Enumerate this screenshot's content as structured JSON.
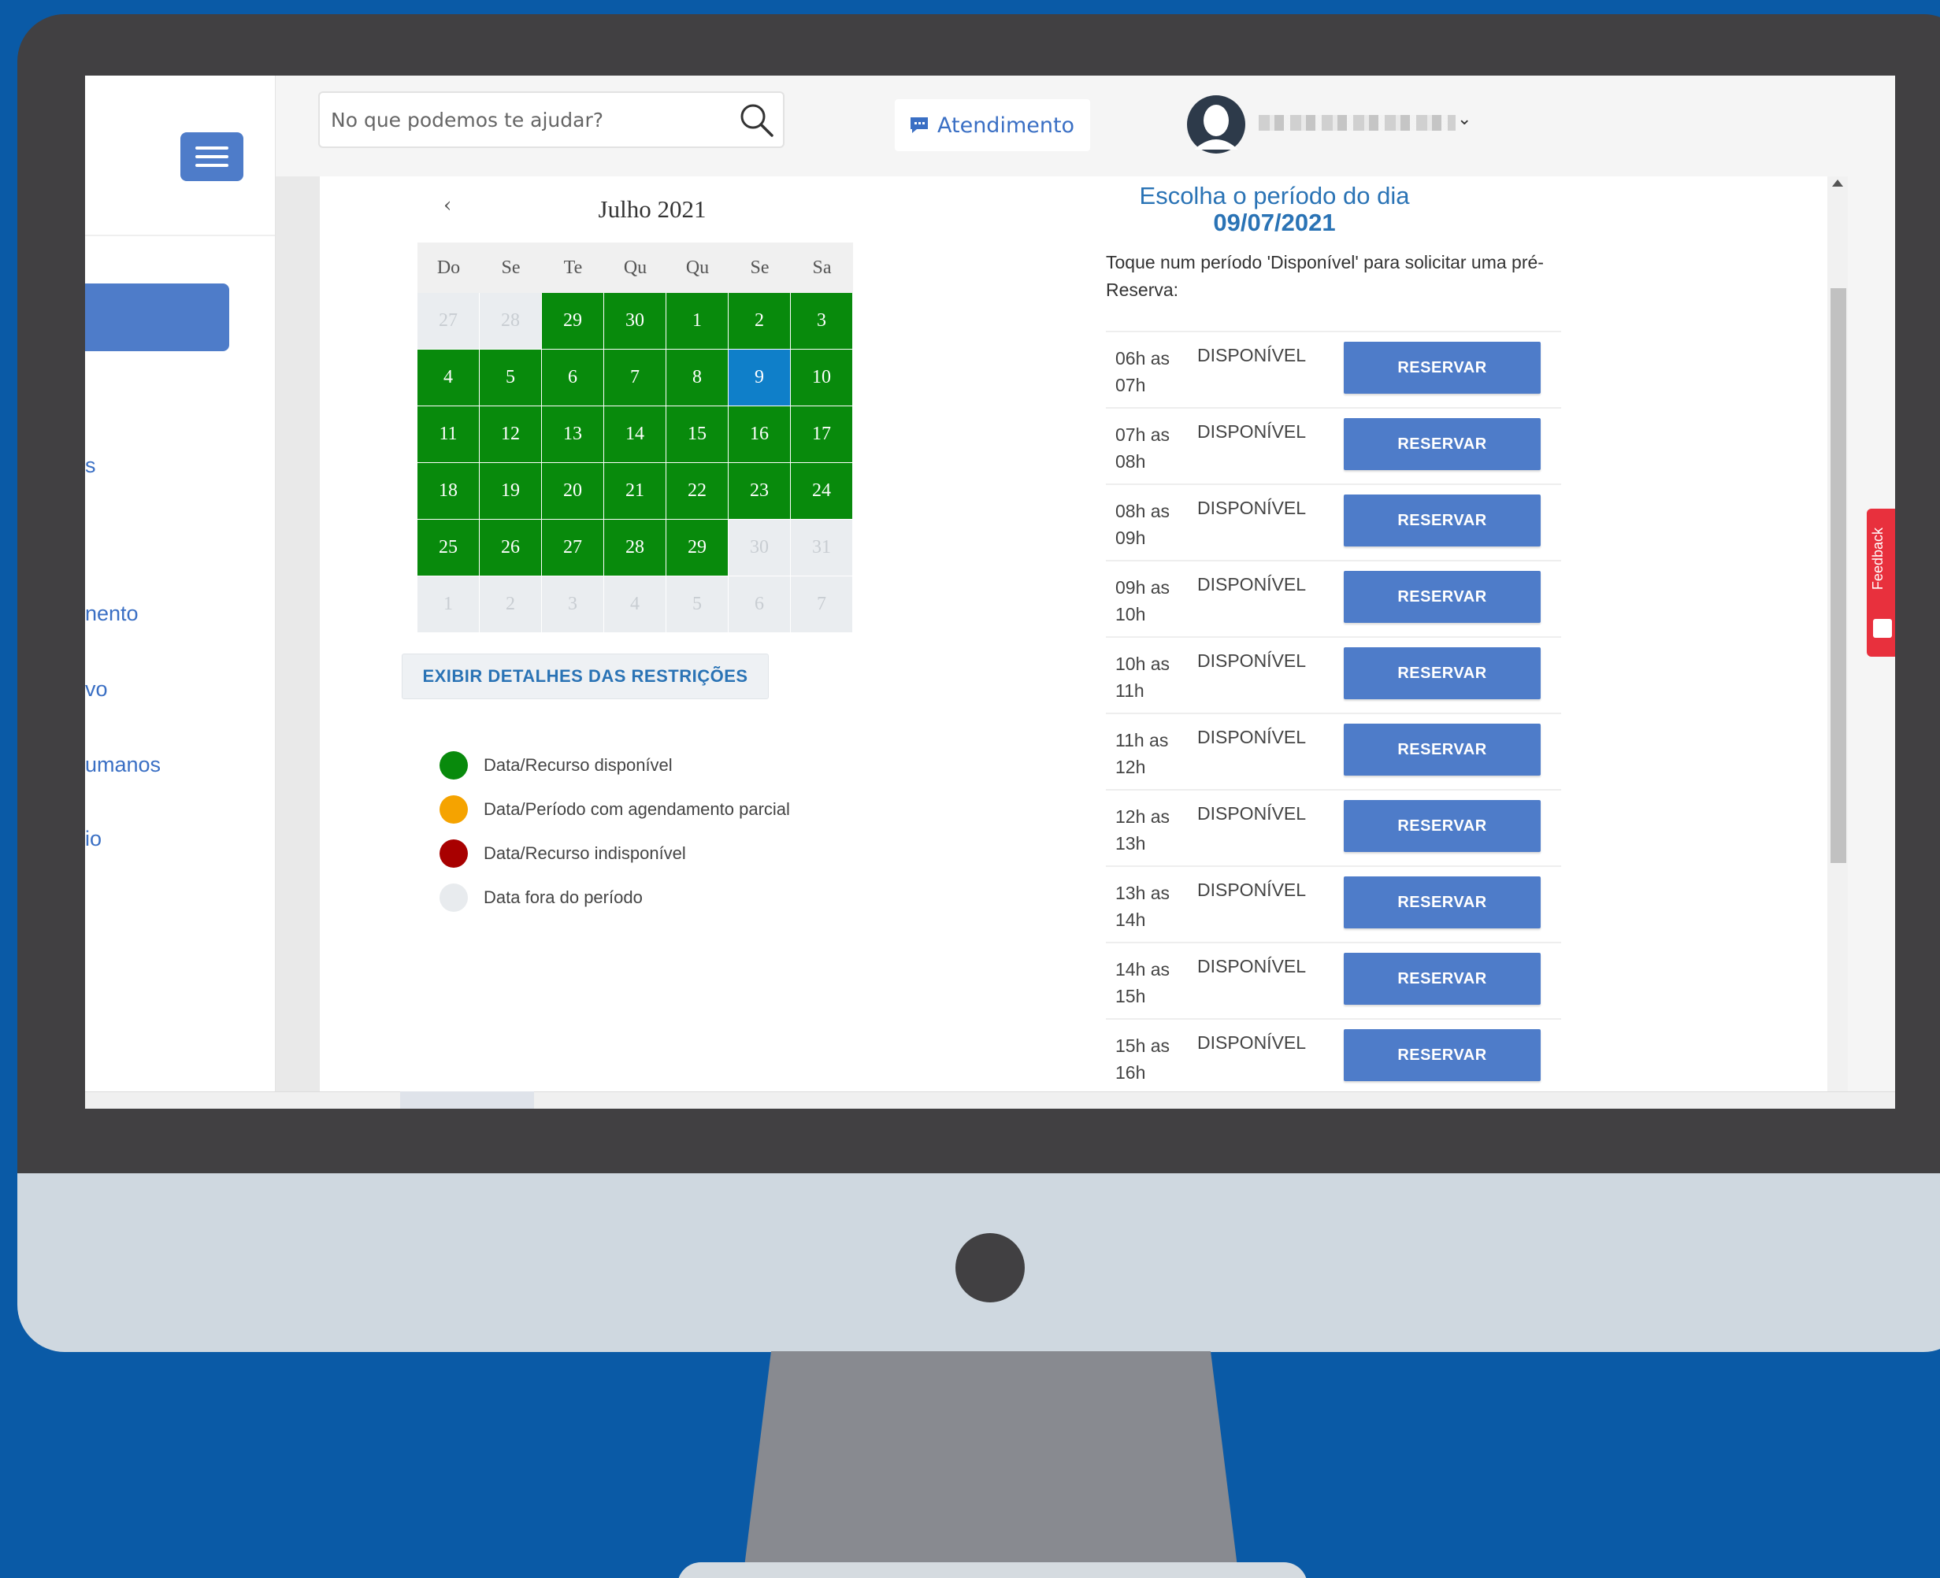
{
  "search": {
    "placeholder": "No que podemos te ajudar?"
  },
  "header": {
    "attend_label": "Atendimento",
    "user_name": ""
  },
  "sidebar": {
    "items": [
      "s",
      "nento",
      "vo",
      "umanos",
      "io"
    ]
  },
  "calendar": {
    "prev_label": "‹",
    "title": "Julho 2021",
    "weekdays": [
      "Do",
      "Se",
      "Te",
      "Qu",
      "Qu",
      "Se",
      "Sa"
    ],
    "days": [
      {
        "label": "27",
        "state": "out"
      },
      {
        "label": "28",
        "state": "out"
      },
      {
        "label": "29",
        "state": "available"
      },
      {
        "label": "30",
        "state": "available"
      },
      {
        "label": "1",
        "state": "available"
      },
      {
        "label": "2",
        "state": "available"
      },
      {
        "label": "3",
        "state": "available"
      },
      {
        "label": "4",
        "state": "available"
      },
      {
        "label": "5",
        "state": "available"
      },
      {
        "label": "6",
        "state": "available"
      },
      {
        "label": "7",
        "state": "available"
      },
      {
        "label": "8",
        "state": "available"
      },
      {
        "label": "9",
        "state": "selected"
      },
      {
        "label": "10",
        "state": "available"
      },
      {
        "label": "11",
        "state": "available"
      },
      {
        "label": "12",
        "state": "available"
      },
      {
        "label": "13",
        "state": "available"
      },
      {
        "label": "14",
        "state": "available"
      },
      {
        "label": "15",
        "state": "available"
      },
      {
        "label": "16",
        "state": "available"
      },
      {
        "label": "17",
        "state": "available"
      },
      {
        "label": "18",
        "state": "available"
      },
      {
        "label": "19",
        "state": "available"
      },
      {
        "label": "20",
        "state": "available"
      },
      {
        "label": "21",
        "state": "available"
      },
      {
        "label": "22",
        "state": "available"
      },
      {
        "label": "23",
        "state": "available"
      },
      {
        "label": "24",
        "state": "available"
      },
      {
        "label": "25",
        "state": "available"
      },
      {
        "label": "26",
        "state": "available"
      },
      {
        "label": "27",
        "state": "available"
      },
      {
        "label": "28",
        "state": "available"
      },
      {
        "label": "29",
        "state": "available"
      },
      {
        "label": "30",
        "state": "out"
      },
      {
        "label": "31",
        "state": "out"
      },
      {
        "label": "1",
        "state": "out"
      },
      {
        "label": "2",
        "state": "out"
      },
      {
        "label": "3",
        "state": "out"
      },
      {
        "label": "4",
        "state": "out"
      },
      {
        "label": "5",
        "state": "out"
      },
      {
        "label": "6",
        "state": "out"
      },
      {
        "label": "7",
        "state": "out"
      }
    ]
  },
  "restrictions_button_label": "EXIBIR DETALHES DAS RESTRIÇÕES",
  "legend": [
    {
      "label": "Data/Recurso disponível",
      "color": "#088a0c"
    },
    {
      "label": "Data/Período com agendamento parcial",
      "color": "#f5a300"
    },
    {
      "label": "Data/Recurso indisponível",
      "color": "#a80000"
    },
    {
      "label": "Data fora do período",
      "color": "#e8ebee"
    }
  ],
  "periods": {
    "heading": "Escolha o período do dia",
    "date": "09/07/2021",
    "instruction": "Toque num período 'Disponível' para solicitar uma pré-Reserva:",
    "reserve_label": "RESERVAR",
    "items": [
      {
        "time_start": "06h as",
        "time_end": "07h",
        "status": "DISPONÍVEL"
      },
      {
        "time_start": "07h as",
        "time_end": "08h",
        "status": "DISPONÍVEL"
      },
      {
        "time_start": "08h as",
        "time_end": "09h",
        "status": "DISPONÍVEL"
      },
      {
        "time_start": "09h as",
        "time_end": "10h",
        "status": "DISPONÍVEL"
      },
      {
        "time_start": "10h as",
        "time_end": "11h",
        "status": "DISPONÍVEL"
      },
      {
        "time_start": "11h as",
        "time_end": "12h",
        "status": "DISPONÍVEL"
      },
      {
        "time_start": "12h as",
        "time_end": "13h",
        "status": "DISPONÍVEL"
      },
      {
        "time_start": "13h as",
        "time_end": "14h",
        "status": "DISPONÍVEL"
      },
      {
        "time_start": "14h as",
        "time_end": "15h",
        "status": "DISPONÍVEL"
      },
      {
        "time_start": "15h as",
        "time_end": "16h",
        "status": "DISPONÍVEL"
      }
    ]
  },
  "feedback_label": "Feedback"
}
